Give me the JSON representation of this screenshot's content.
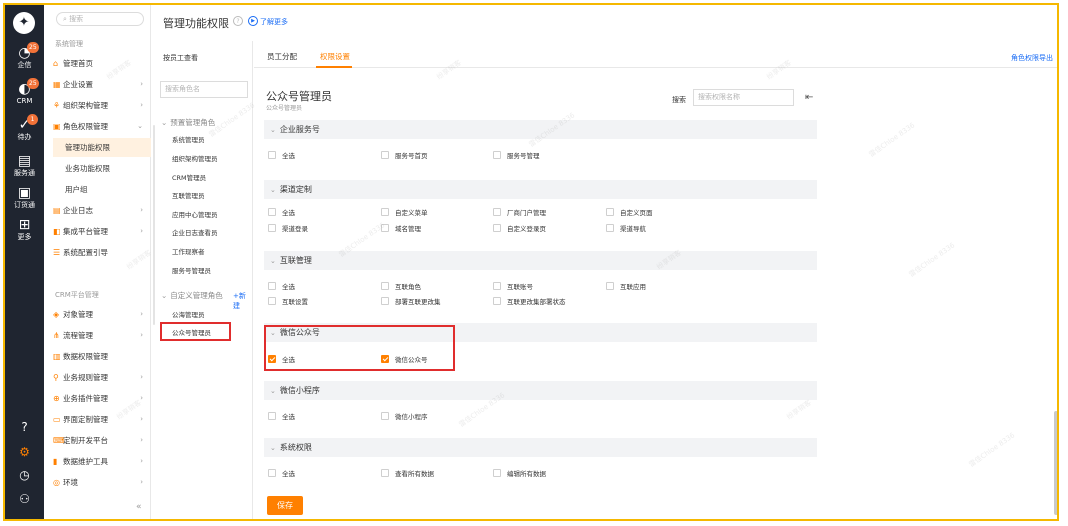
{
  "sidebar_icons": {
    "items": [
      {
        "label": "企信",
        "badge": "25",
        "icon": "chat-bubble-icon"
      },
      {
        "label": "CRM",
        "badge": "25",
        "icon": "crm-icon"
      },
      {
        "label": "待办",
        "badge": "1",
        "icon": "todo-check-icon"
      },
      {
        "label": "服务通",
        "icon": "service-icon"
      },
      {
        "label": "订货通",
        "icon": "order-icon"
      },
      {
        "label": "更多",
        "icon": "grid-icon"
      }
    ],
    "bottom_icons": [
      "help-icon",
      "settings-gear-icon",
      "clock-icon",
      "contacts-icon"
    ]
  },
  "menu": {
    "search_placeholder": "搜索",
    "section_system": "系统管理",
    "items": [
      {
        "label": "管理首页",
        "icon": "home-icon",
        "arrow": ""
      },
      {
        "label": "企业设置",
        "icon": "company-icon",
        "arrow": "›"
      },
      {
        "label": "组织架构管理",
        "icon": "org-icon",
        "arrow": "›"
      },
      {
        "label": "角色权限管理",
        "icon": "role-icon",
        "arrow": "⌄"
      },
      {
        "label": "管理功能权限",
        "icon": "",
        "arrow": ""
      },
      {
        "label": "业务功能权限",
        "icon": "",
        "arrow": ""
      },
      {
        "label": "用户组",
        "icon": "",
        "arrow": ""
      },
      {
        "label": "企业日志",
        "icon": "log-icon",
        "arrow": "›"
      },
      {
        "label": "集成平台管理",
        "icon": "integration-icon",
        "arrow": "›"
      },
      {
        "label": "系统配置引导",
        "icon": "guide-icon",
        "arrow": ""
      }
    ],
    "section_crm": "CRM平台管理",
    "crm_items": [
      {
        "label": "对象管理",
        "icon": "object-icon",
        "arrow": "›"
      },
      {
        "label": "流程管理",
        "icon": "flow-icon",
        "arrow": "›"
      },
      {
        "label": "数据权限管理",
        "icon": "data-permission-icon",
        "arrow": ""
      },
      {
        "label": "业务规则管理",
        "icon": "rule-icon",
        "arrow": "›"
      },
      {
        "label": "业务插件管理",
        "icon": "plugin-icon",
        "arrow": "›"
      },
      {
        "label": "界面定制管理",
        "icon": "ui-custom-icon",
        "arrow": "›"
      },
      {
        "label": "定制开发平台",
        "icon": "dev-platform-icon",
        "arrow": "›"
      },
      {
        "label": "数据维护工具",
        "icon": "data-tool-icon",
        "arrow": "›"
      },
      {
        "label": "环境",
        "icon": "environment-icon",
        "arrow": "›"
      }
    ]
  },
  "header": {
    "title": "管理功能权限",
    "learn_more": "了解更多"
  },
  "roles": {
    "tab_label": "按员工查看",
    "search_placeholder": "搜索角色名",
    "preset_group": "预置管理角色",
    "preset_items": [
      "系统管理员",
      "组织架构管理员",
      "CRM管理员",
      "互联管理员",
      "应用中心管理员",
      "企业日志查看员",
      "工作现察者",
      "服务号管理员"
    ],
    "custom_group": "自定义管理角色",
    "add_label": "+新建",
    "custom_items": [
      "公海管理员",
      "公众号管理员"
    ]
  },
  "main": {
    "tabs": [
      "员工分配",
      "权限设置"
    ],
    "active_tab": 1,
    "export_label": "角色权限导出",
    "role_title": "公众号管理员",
    "role_subtitle": "公众号管理员",
    "search_label": "搜索",
    "search_placeholder": "搜索权限名称",
    "sections": [
      {
        "title": "企业服务号",
        "options": [
          {
            "label": "全选",
            "checked": false
          },
          {
            "label": "服务号首页",
            "checked": false
          },
          {
            "label": "服务号管理",
            "checked": false
          }
        ]
      },
      {
        "title": "渠道定制",
        "options": [
          {
            "label": "全选",
            "checked": false
          },
          {
            "label": "自定义菜单",
            "checked": false
          },
          {
            "label": "厂商门户管理",
            "checked": false
          },
          {
            "label": "自定义页面",
            "checked": false
          },
          {
            "label": "渠道登录",
            "checked": false
          },
          {
            "label": "域名管理",
            "checked": false
          },
          {
            "label": "自定义登录页",
            "checked": false
          },
          {
            "label": "渠道导航",
            "checked": false
          }
        ]
      },
      {
        "title": "互联管理",
        "options": [
          {
            "label": "全选",
            "checked": false
          },
          {
            "label": "互联角色",
            "checked": false
          },
          {
            "label": "互联账号",
            "checked": false
          },
          {
            "label": "互联应用",
            "checked": false
          },
          {
            "label": "互联设置",
            "checked": false
          },
          {
            "label": "部署互联更改集",
            "checked": false
          },
          {
            "label": "互联更改集部署状态",
            "checked": false
          }
        ]
      },
      {
        "title": "微信公众号",
        "options": [
          {
            "label": "全选",
            "checked": true
          },
          {
            "label": "微信公众号",
            "checked": true
          }
        ]
      },
      {
        "title": "微信小程序",
        "options": [
          {
            "label": "全选",
            "checked": false
          },
          {
            "label": "微信小程序",
            "checked": false
          }
        ]
      },
      {
        "title": "系统权限",
        "options": [
          {
            "label": "全选",
            "checked": false
          },
          {
            "label": "查看所有数据",
            "checked": false
          },
          {
            "label": "编辑所有数据",
            "checked": false
          }
        ]
      }
    ],
    "save_label": "保存"
  },
  "watermark": [
    "纷享销客",
    "雷佳Chloe 8336"
  ],
  "colors": {
    "accent": "#ff8000",
    "sidebar_bg": "#1f2530",
    "link": "#1b6df5",
    "highlight": "#e02d2d"
  }
}
